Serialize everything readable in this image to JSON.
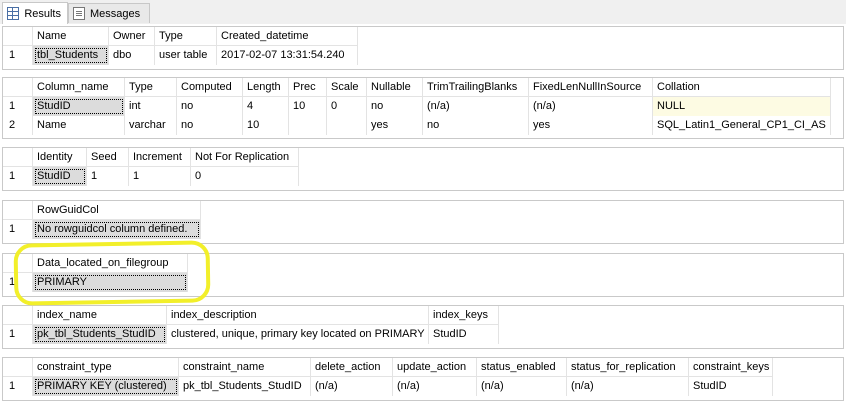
{
  "tabs": [
    {
      "label": "Results",
      "icon": "results-grid-icon"
    },
    {
      "label": "Messages",
      "icon": "messages-icon"
    }
  ],
  "table_info": {
    "headers": [
      "Name",
      "Owner",
      "Type",
      "Created_datetime"
    ],
    "rows": [
      [
        "1",
        "tbl_Students",
        "dbo",
        "user table",
        "2017-02-07 13:31:54.240"
      ]
    ]
  },
  "columns_info": {
    "headers": [
      "Column_name",
      "Type",
      "Computed",
      "Length",
      "Prec",
      "Scale",
      "Nullable",
      "TrimTrailingBlanks",
      "FixedLenNullInSource",
      "Collation"
    ],
    "rows": [
      [
        "1",
        "StudID",
        "int",
        "no",
        "4",
        "10",
        "0",
        "no",
        "(n/a)",
        "(n/a)",
        "NULL"
      ],
      [
        "2",
        "Name",
        "varchar",
        "no",
        "10",
        "",
        "",
        "yes",
        "no",
        "yes",
        "SQL_Latin1_General_CP1_CI_AS"
      ]
    ]
  },
  "identity_info": {
    "headers": [
      "Identity",
      "Seed",
      "Increment",
      "Not For Replication"
    ],
    "rows": [
      [
        "1",
        "StudID",
        "1",
        "1",
        "0"
      ]
    ]
  },
  "rowguid_info": {
    "headers": [
      "RowGuidCol"
    ],
    "rows": [
      [
        "1",
        "No rowguidcol column defined."
      ]
    ]
  },
  "filegroup_info": {
    "headers": [
      "Data_located_on_filegroup"
    ],
    "rows": [
      [
        "1",
        "PRIMARY"
      ]
    ]
  },
  "index_info": {
    "headers": [
      "index_name",
      "index_description",
      "index_keys"
    ],
    "rows": [
      [
        "1",
        "pk_tbl_Students_StudID",
        "clustered, unique, primary key located on PRIMARY",
        "StudID"
      ]
    ]
  },
  "constraint_info": {
    "headers": [
      "constraint_type",
      "constraint_name",
      "delete_action",
      "update_action",
      "status_enabled",
      "status_for_replication",
      "constraint_keys"
    ],
    "rows": [
      [
        "1",
        "PRIMARY KEY (clustered)",
        "pk_tbl_Students_StudID",
        "(n/a)",
        "(n/a)",
        "(n/a)",
        "(n/a)",
        "StudID"
      ]
    ]
  },
  "annotation_color": "#f2ef2a",
  "highlight_color": "#fdfbe3"
}
